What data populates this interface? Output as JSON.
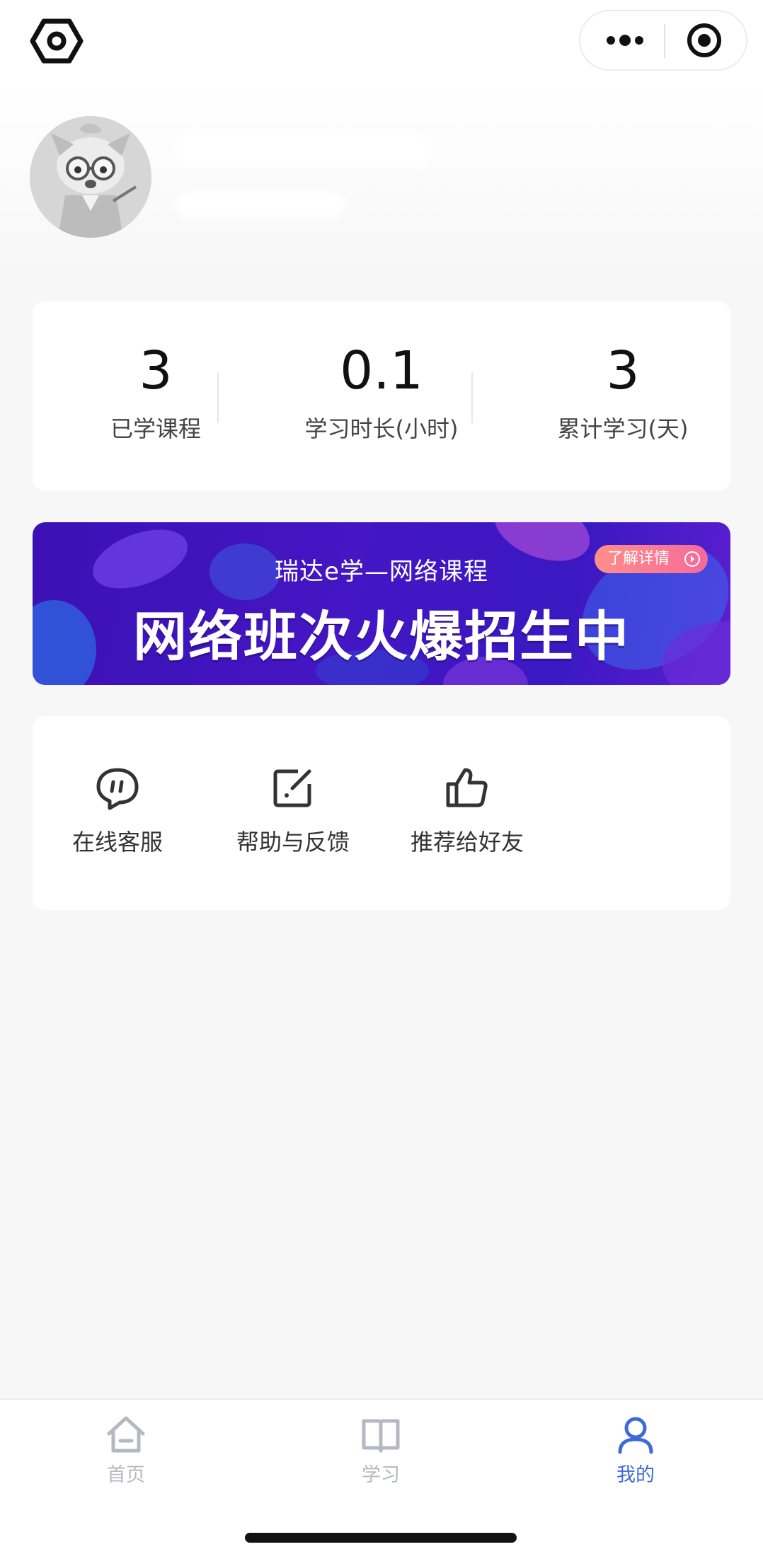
{
  "stats": [
    {
      "value": "3",
      "label": "已学课程"
    },
    {
      "value": "0.1",
      "label": "学习时长(小时)"
    },
    {
      "value": "3",
      "label": "累计学习(天)"
    }
  ],
  "banner": {
    "subtitle": "瑞达e学—网络课程",
    "title": "网络班次火爆招生中",
    "detail_label": "了解详情"
  },
  "tools": [
    {
      "label": "在线客服",
      "icon": "chat-bubble-icon"
    },
    {
      "label": "帮助与反馈",
      "icon": "edit-feedback-icon"
    },
    {
      "label": "推荐给好友",
      "icon": "thumbs-up-icon"
    }
  ],
  "tabbar": [
    {
      "label": "首页",
      "icon": "home-icon",
      "active": false
    },
    {
      "label": "学习",
      "icon": "book-icon",
      "active": false
    },
    {
      "label": "我的",
      "icon": "user-icon",
      "active": true
    }
  ],
  "colors": {
    "active_tab": "#3e6ad8",
    "inactive_tab": "#b4b8c2",
    "banner": "#4416c4",
    "badge": "#f56a9a"
  }
}
